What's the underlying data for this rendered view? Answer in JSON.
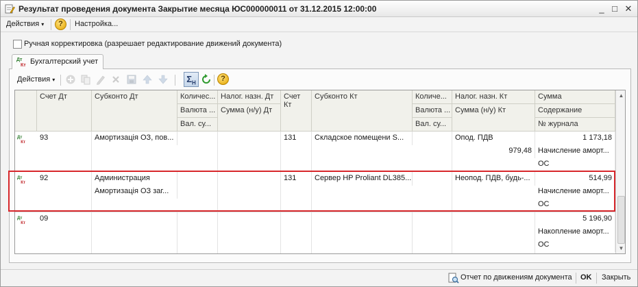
{
  "window": {
    "title": "Результат проведения документа Закрытие месяца ЮС000000011 от 31.12.2015 12:00:00",
    "controls": {
      "minimize": "_",
      "maximize": "□",
      "close": "✕"
    }
  },
  "menubar": {
    "actions_label": "Действия",
    "help_label": "?",
    "settings_label": "Настройка..."
  },
  "manual_edit": {
    "label": "Ручная корректировка (разрешает редактирование движений документа)",
    "checked": false
  },
  "tabs": [
    {
      "label": "Бухгалтерский учет",
      "icon": "dt-kt-icon"
    }
  ],
  "table_toolbar": {
    "actions_label": "Действия",
    "sigma_label": "Σ",
    "sigma_sub": "Н",
    "help_label": "?"
  },
  "grid": {
    "headers": {
      "schet_dt": "Счет Дт",
      "subkonto_dt": "Субконто Дт",
      "kolich_dt": "Количес...",
      "valuta_dt": "Валюта ...",
      "valsu_dt": "Вал. су...",
      "nalog_dt": "Налог. назн. Дт",
      "summa_nu_dt": "Сумма (н/у) Дт",
      "schet_kt": "Счет Кт",
      "subkonto_kt": "Субконто Кт",
      "kolich_kt": "Количе...",
      "valuta_kt": "Валюта ...",
      "valsu_kt": "Вал. су...",
      "nalog_kt": "Налог. назн. Кт",
      "summa_nu_kt": "Сумма (н/у) Кт",
      "summa": "Сумма",
      "soderzhanie": "Содержание",
      "nomer_zhurnala": "№ журнала"
    },
    "rows": [
      {
        "schet_dt": "93",
        "subkonto_dt": [
          "Амортизація ОЗ, пов...",
          ""
        ],
        "schet_kt": "131",
        "subkonto_kt": "Складское помещени S...",
        "nalog_kt": "Опод. ПДВ",
        "summa_nu_kt": "979,48",
        "summa": "1 173,18",
        "soderzhanie": "Начисление аморт...",
        "nomer_zhurnala": "ОС"
      },
      {
        "schet_dt": "92",
        "subkonto_dt": [
          "Администрация",
          "Амортизація ОЗ заг..."
        ],
        "schet_kt": "131",
        "subkonto_kt": "Сервер HP Proliant DL385...",
        "nalog_kt": "Неопод. ПДВ, будь-...",
        "summa_nu_kt": "",
        "summa": "514,99",
        "soderzhanie": "Начисление аморт...",
        "nomer_zhurnala": "ОС"
      },
      {
        "schet_dt": "09",
        "subkonto_dt": [
          "",
          ""
        ],
        "schet_kt": "",
        "subkonto_kt": "",
        "nalog_kt": "",
        "summa_nu_kt": "",
        "summa": "5 196,90",
        "soderzhanie": "Накопление аморт...",
        "nomer_zhurnala": "ОС"
      }
    ]
  },
  "statusbar": {
    "report_label": "Отчет по движениям документа",
    "ok_label": "OK",
    "close_label": "Закрыть"
  },
  "colors": {
    "highlight": "#d7262a",
    "header_bg": "#f1f1eb",
    "accent": "#d7262a"
  }
}
